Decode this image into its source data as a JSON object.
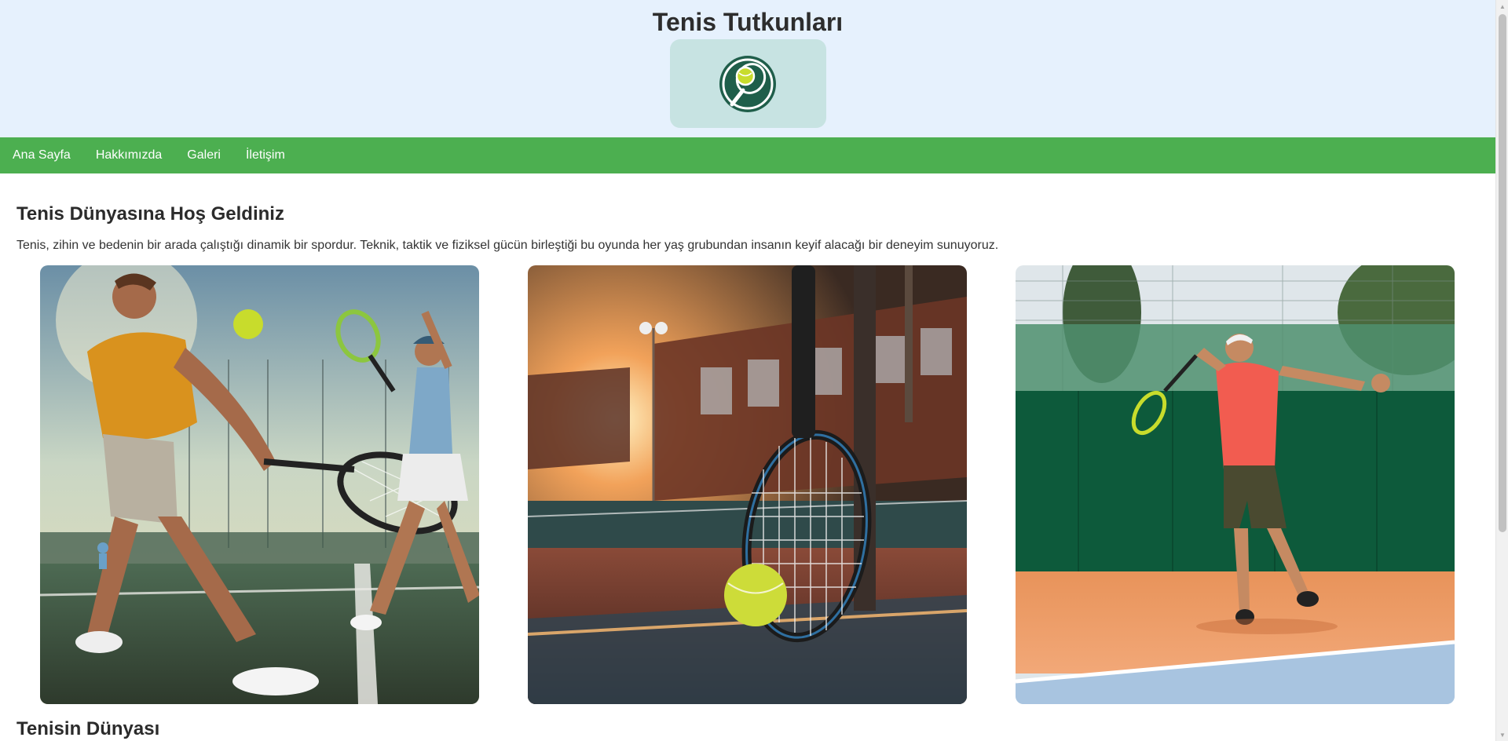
{
  "header": {
    "title": "Tenis Tutkunları",
    "logo_icon": "tennis-racket-ball-logo"
  },
  "nav": {
    "items": [
      "Ana Sayfa",
      "Hakkımızda",
      "Galeri",
      "İletişim"
    ]
  },
  "main": {
    "welcome_title": "Tenis Dünyasına Hoş Geldiniz",
    "intro_text": "Tenis, zihin ve bedenin bir arada çalıştığı dinamik bir spordur. Teknik, taktik ve fiziksel gücün birleştiği bu oyunda her yaş grubundan insanın keyif alacağı bir deneyim sunuyoruz.",
    "gallery": [
      {
        "subject": "mixed-doubles-players-photo"
      },
      {
        "subject": "racket-and-ball-on-court-photo"
      },
      {
        "subject": "player-serving-on-clay-photo"
      }
    ],
    "section2_title": "Tenisin Dünyası"
  },
  "colors": {
    "header_bg": "#e6f1fd",
    "logo_bg": "#c7e3e2",
    "nav_bg": "#4caf50",
    "nav_text": "#ffffff",
    "logo_green": "#1f5e4a",
    "ball": "#c8dc2c"
  }
}
